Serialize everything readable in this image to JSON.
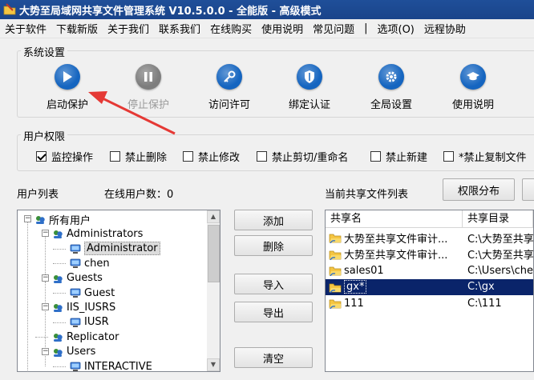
{
  "window": {
    "title": "大势至局域网共享文件管理系统 V10.5.0.0 - 全能版 - 高级模式"
  },
  "menu": [
    "关于软件",
    "下载新版",
    "关于我们",
    "联系我们",
    "在线购买",
    "使用说明",
    "常见问题",
    "|",
    "选项(O)",
    "远程协助"
  ],
  "system_settings": {
    "title": "系统设置",
    "buttons": [
      {
        "label": "启动保护",
        "icon": "play-icon",
        "color": "#1565c0",
        "enabled": true
      },
      {
        "label": "停止保护",
        "icon": "pause-icon",
        "color": "#7d7d7d",
        "enabled": false
      },
      {
        "label": "访问许可",
        "icon": "key-icon",
        "color": "#1565c0",
        "enabled": true
      },
      {
        "label": "绑定认证",
        "icon": "shield-icon",
        "color": "#1565c0",
        "enabled": true
      },
      {
        "label": "全局设置",
        "icon": "gear-icon",
        "color": "#1565c0",
        "enabled": true
      },
      {
        "label": "使用说明",
        "icon": "graduation-cap-icon",
        "color": "#1565c0",
        "enabled": true
      }
    ]
  },
  "user_permissions": {
    "title": "用户权限",
    "checks": [
      {
        "label": "监控操作",
        "checked": true
      },
      {
        "label": "禁止删除",
        "checked": false
      },
      {
        "label": "禁止修改",
        "checked": false
      },
      {
        "label": "禁止剪切/重命名",
        "checked": false
      },
      {
        "label": "禁止新建",
        "checked": false
      },
      {
        "label": "*禁止复制文件",
        "checked": false
      }
    ]
  },
  "user_list": {
    "label": "用户列表",
    "online_label": "在线用户数：0",
    "tree": [
      {
        "label": "所有用户",
        "level": 0,
        "kind": "group",
        "expander": "−"
      },
      {
        "label": "Administrators",
        "level": 1,
        "kind": "group",
        "expander": "−"
      },
      {
        "label": "Administrator",
        "level": 2,
        "kind": "user",
        "selected": true
      },
      {
        "label": "chen",
        "level": 2,
        "kind": "user"
      },
      {
        "label": "Guests",
        "level": 1,
        "kind": "group",
        "expander": "−"
      },
      {
        "label": "Guest",
        "level": 2,
        "kind": "user"
      },
      {
        "label": "IIS_IUSRS",
        "level": 1,
        "kind": "group",
        "expander": "−"
      },
      {
        "label": "IUSR",
        "level": 2,
        "kind": "user"
      },
      {
        "label": "Replicator",
        "level": 1,
        "kind": "group"
      },
      {
        "label": "Users",
        "level": 1,
        "kind": "group",
        "expander": "−"
      },
      {
        "label": "INTERACTIVE",
        "level": 2,
        "kind": "user"
      }
    ]
  },
  "actions": {
    "add": "添加",
    "delete": "删除",
    "import": "导入",
    "export": "导出",
    "clear": "清空"
  },
  "share_list": {
    "label": "当前共享文件列表",
    "perm_button": "权限分布",
    "columns": [
      "共享名",
      "共享目录"
    ],
    "rows": [
      {
        "name": "大势至共享文件审计...",
        "path": "C:\\大势至共享",
        "selected": false,
        "icon": "shared-folder-icon"
      },
      {
        "name": "大势至共享文件审计...",
        "path": "C:\\大势至共享",
        "selected": false,
        "icon": "shared-folder-icon"
      },
      {
        "name": "sales01",
        "path": "C:\\Users\\che",
        "selected": false,
        "icon": "shared-folder-icon"
      },
      {
        "name": "gx*",
        "path": "C:\\gx",
        "selected": true,
        "icon": "shared-folder-icon"
      },
      {
        "name": "111",
        "path": "C:\\111",
        "selected": false,
        "icon": "shared-folder-icon"
      }
    ]
  },
  "colors": {
    "titlebar": "#1f4f99",
    "accent_blue": "#1565c0",
    "selection": "#0a246a",
    "arrow": "#e53935"
  }
}
